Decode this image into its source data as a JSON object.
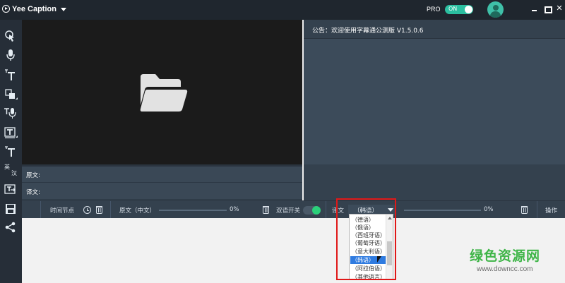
{
  "app": {
    "title": "Yee Caption"
  },
  "header": {
    "pro_label": "PRO",
    "pro_toggle_text": "ON"
  },
  "window_controls": {
    "close": "✕"
  },
  "sidebar": {
    "tools": [
      {
        "icon": "cursor-icon"
      },
      {
        "icon": "microphone-icon"
      },
      {
        "icon": "text-style-icon"
      },
      {
        "icon": "shape-icon"
      },
      {
        "icon": "voice-text-icon"
      },
      {
        "icon": "text-box-icon"
      },
      {
        "icon": "text-icon"
      },
      {
        "icon": "translate-icon",
        "label_top": "英",
        "label_bottom": "汉"
      },
      {
        "icon": "text-export-icon"
      },
      {
        "icon": "save-icon"
      },
      {
        "icon": "share-icon"
      }
    ]
  },
  "notice": {
    "text": "公告：欢迎使用字幕通公测版 V1.5.0.6"
  },
  "lines": {
    "source_label": "原文:",
    "translation_label": "译文:"
  },
  "columns": {
    "time": "时间节点",
    "source": "原文（中文）",
    "source_pct": "0%",
    "bilingual": "双语开关",
    "translation": "译文",
    "target_lang": "（韩语）",
    "target_pct": "0%",
    "action": "操作"
  },
  "dropdown": {
    "options": [
      "（德语）",
      "（俄语）",
      "（西班牙语）",
      "（葡萄牙语）",
      "（意大利语）",
      "（韩语）",
      "（阿拉伯语）",
      "（其他语言）"
    ],
    "selected": "（韩语）"
  },
  "watermark": {
    "title": "绿色资源网",
    "url": "www.downcc.com"
  },
  "colors": {
    "accent": "#2bbfa0",
    "toggle_on": "#2bd07a",
    "selection": "#2f7be0",
    "highlight": "#e01818"
  }
}
